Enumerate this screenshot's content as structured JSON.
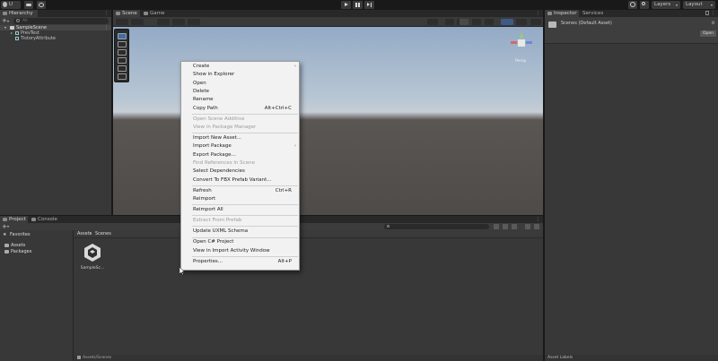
{
  "toolbar": {
    "account_label": "U",
    "play_icon": "play-icon",
    "pause_icon": "pause-icon",
    "step_icon": "step-icon",
    "layers_label": "Layers",
    "layout_label": "Layout"
  },
  "hierarchy": {
    "tab_label": "Hierarchy",
    "search_placeholder": "All",
    "scene_name": "SampleScene",
    "items": [
      "PrevTest",
      "TistoryAttribute"
    ]
  },
  "scene": {
    "tab_scene": "Scene",
    "tab_game": "Game",
    "gizmo_label": "Persp"
  },
  "context_menu": {
    "items": [
      {
        "label": "Create",
        "shortcut": "",
        "submenu": true,
        "disabled": false
      },
      {
        "label": "Show in Explorer",
        "shortcut": "",
        "submenu": false,
        "disabled": false
      },
      {
        "label": "Open",
        "shortcut": "",
        "submenu": false,
        "disabled": false
      },
      {
        "label": "Delete",
        "shortcut": "",
        "submenu": false,
        "disabled": false
      },
      {
        "label": "Rename",
        "shortcut": "",
        "submenu": false,
        "disabled": false
      },
      {
        "label": "Copy Path",
        "shortcut": "Alt+Ctrl+C",
        "submenu": false,
        "disabled": false
      },
      {
        "label": "Open Scene Additive",
        "shortcut": "",
        "submenu": false,
        "disabled": true
      },
      {
        "label": "View in Package Manager",
        "shortcut": "",
        "submenu": false,
        "disabled": true
      },
      {
        "label": "Import New Asset...",
        "shortcut": "",
        "submenu": false,
        "disabled": false
      },
      {
        "label": "Import Package",
        "shortcut": "",
        "submenu": true,
        "disabled": false
      },
      {
        "label": "Export Package...",
        "shortcut": "",
        "submenu": false,
        "disabled": false
      },
      {
        "label": "Find References In Scene",
        "shortcut": "",
        "submenu": false,
        "disabled": true
      },
      {
        "label": "Select Dependencies",
        "shortcut": "",
        "submenu": false,
        "disabled": false
      },
      {
        "label": "Convert To FBX Prefab Variant...",
        "shortcut": "",
        "submenu": false,
        "disabled": false
      },
      {
        "label": "Refresh",
        "shortcut": "Ctrl+R",
        "submenu": false,
        "disabled": false
      },
      {
        "label": "Reimport",
        "shortcut": "",
        "submenu": false,
        "disabled": false
      },
      {
        "label": "Reimport All",
        "shortcut": "",
        "submenu": false,
        "disabled": false
      },
      {
        "label": "Extract From Prefab",
        "shortcut": "",
        "submenu": false,
        "disabled": true
      },
      {
        "label": "Update UXML Schema",
        "shortcut": "",
        "submenu": false,
        "disabled": false
      },
      {
        "label": "Open C# Project",
        "shortcut": "",
        "submenu": false,
        "disabled": false
      },
      {
        "label": "View in Import Activity Window",
        "shortcut": "",
        "submenu": false,
        "disabled": false
      },
      {
        "label": "Properties...",
        "shortcut": "Alt+P",
        "submenu": false,
        "disabled": false
      }
    ]
  },
  "project": {
    "tab_project": "Project",
    "tab_console": "Console",
    "favorites_label": "Favorites",
    "tree": [
      "Assets",
      "Packages"
    ],
    "breadcrumb_root": "Assets",
    "breadcrumb_sep": "›",
    "breadcrumb_current": "Scenes",
    "asset_name": "SampleSc...",
    "footer_path": "Assets/Scenes"
  },
  "inspector": {
    "tab_inspector": "Inspector",
    "tab_services": "Services",
    "asset_title": "Scenes (Default Asset)",
    "open_button": "Open",
    "asset_labels": "Asset Labels"
  }
}
